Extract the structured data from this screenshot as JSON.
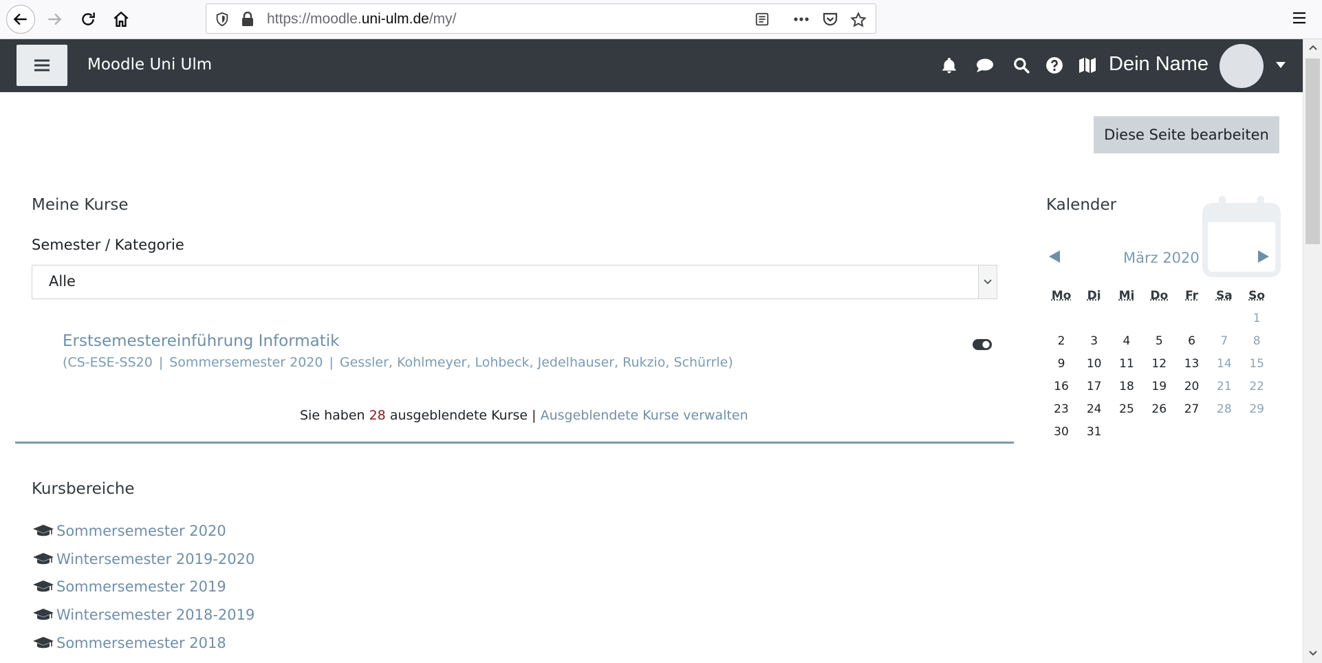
{
  "browser": {
    "url_prefix": "https://moodle.",
    "url_host": "uni-ulm.de",
    "url_path": "/my/"
  },
  "navbar": {
    "site_name": "Moodle Uni Ulm",
    "user_name": "Dein Name",
    "icons": [
      "bell-icon",
      "chat-icon",
      "search-icon",
      "help-icon",
      "map-icon"
    ],
    "bg_color": "#343a40"
  },
  "page": {
    "edit_button": "Diese Seite bearbeiten"
  },
  "my_courses": {
    "title": "Meine Kurse",
    "filter_label": "Semester / Kategorie",
    "filter_value": "Alle",
    "course": {
      "name": "Erstsemestereinführung Informatik",
      "meta_open": "(",
      "short_name": "CS-ESE-SS20",
      "sep1": "|",
      "semester": "Sommersemester 2020",
      "sep2": "|",
      "teachers": "Gessler, Kohlmeyer, Lohbeck, Jedelhauser, Rukzio, Schürrle)"
    },
    "hidden_prefix": "Sie haben ",
    "hidden_count": "28",
    "hidden_suffix": " ausgeblendete Kurse | ",
    "hidden_manage": "Ausgeblendete Kurse verwalten",
    "link_color": "#6f8fa9"
  },
  "course_categories": {
    "title": "Kursbereiche",
    "items": [
      "Sommersemester 2020",
      "Wintersemester 2019-2020",
      "Sommersemester 2019",
      "Wintersemester 2018-2019",
      "Sommersemester 2018"
    ]
  },
  "calendar": {
    "title": "Kalender",
    "month": "März 2020",
    "prev": "◀",
    "next": "▶",
    "weekdays": [
      "Mo",
      "Di",
      "Mi",
      "Do",
      "Fr",
      "Sa",
      "So"
    ],
    "weeks": [
      [
        "",
        "",
        "",
        "",
        "",
        "",
        "1"
      ],
      [
        "2",
        "3",
        "4",
        "5",
        "6",
        "7",
        "8"
      ],
      [
        "9",
        "10",
        "11",
        "12",
        "13",
        "14",
        "15"
      ],
      [
        "16",
        "17",
        "18",
        "19",
        "20",
        "21",
        "22"
      ],
      [
        "23",
        "24",
        "25",
        "26",
        "27",
        "28",
        "29"
      ],
      [
        "30",
        "31",
        "",
        "",
        "",
        "",
        ""
      ]
    ]
  }
}
